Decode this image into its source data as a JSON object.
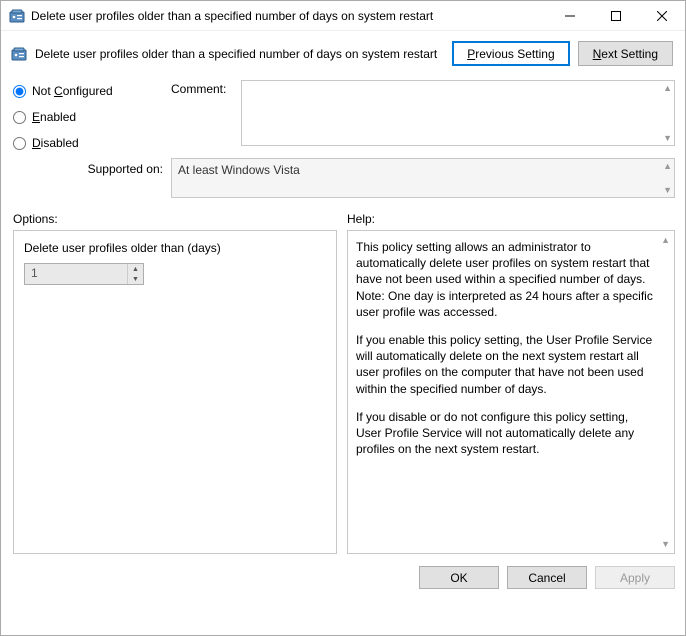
{
  "window": {
    "title": "Delete user profiles older than a specified number of days on system restart"
  },
  "header": {
    "text": "Delete user profiles older than a specified number of days on system restart",
    "prev": "revious Setting",
    "prev_ul": "P",
    "next": "ext Setting",
    "next_ul": "N"
  },
  "state": {
    "not_configured": "Not ",
    "not_configured_ul": "C",
    "not_configured_rest": "onfigured",
    "enabled_ul": "E",
    "enabled_rest": "nabled",
    "disabled_ul": "D",
    "disabled_rest": "isabled"
  },
  "labels": {
    "comment": "Comment:",
    "supported": "Supported on:",
    "options": "Options:",
    "help": "Help:"
  },
  "supported_on": "At least Windows Vista",
  "options": {
    "field_label": "Delete user profiles older than (days)",
    "value": "1"
  },
  "help": {
    "p1": "This policy setting allows an administrator to automatically delete user profiles on system restart that have not been used within a specified number of days. Note: One day is interpreted as 24 hours after a specific user profile was accessed.",
    "p2": "If you enable this policy setting, the User Profile Service will automatically delete on the next system restart all user profiles on the computer that have not been used within the specified number of days.",
    "p3": "If you disable or do not configure this policy setting, User Profile Service will not automatically delete any profiles on the next system restart."
  },
  "footer": {
    "ok": "OK",
    "cancel": "Cancel",
    "apply": "Apply"
  }
}
